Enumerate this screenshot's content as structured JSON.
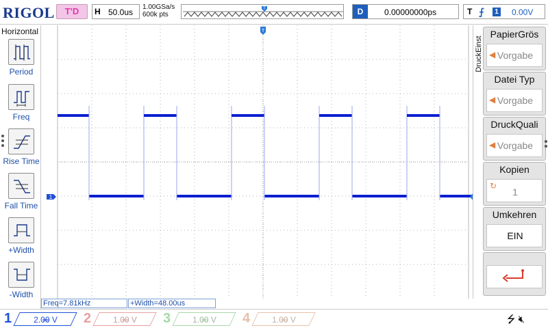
{
  "topbar": {
    "brand": "RIGOL",
    "trigger_state": "T'D",
    "horizontal_label": "H",
    "horizontal_timebase": "50.0us",
    "sample_rate": "1.00GSa/s",
    "memory_depth": "600k pts",
    "delay_label": "D",
    "delay_value": "0.00000000ps",
    "trigger_label": "T",
    "trigger_source": "1",
    "trigger_level": "0.00V"
  },
  "left_menu": {
    "title": "Horizontal",
    "items": [
      {
        "label": "Period",
        "icon": "period-icon"
      },
      {
        "label": "Freq",
        "icon": "frequency-icon"
      },
      {
        "label": "Rise Time",
        "icon": "rise-time-icon"
      },
      {
        "label": "Fall Time",
        "icon": "fall-time-icon"
      },
      {
        "label": "+Width",
        "icon": "positive-width-icon"
      },
      {
        "label": "-Width",
        "icon": "negative-width-icon"
      }
    ]
  },
  "right_menu": {
    "side_label": "DruckEinst",
    "items": [
      {
        "title": "PapierGrös",
        "value": "Vorgabe"
      },
      {
        "title": "Datei Typ",
        "value": "Vorgabe"
      },
      {
        "title": "DruckQuali",
        "value": "Vorgabe"
      },
      {
        "title": "Kopien",
        "value": "1"
      },
      {
        "title": "Umkehren",
        "value": "EIN"
      }
    ],
    "print_icon": "return-arrow-icon"
  },
  "measurements": {
    "freq": "Freq=7.81kHz",
    "pwidth": "+Width=48.00us"
  },
  "channels": [
    {
      "num": "1",
      "scale": "2.00 V",
      "color": "#1e4fd8",
      "active": true
    },
    {
      "num": "2",
      "scale": "1.00 V",
      "color": "#e8a0a0",
      "active": false
    },
    {
      "num": "3",
      "scale": "1.00 V",
      "color": "#a8d8a8",
      "active": false
    },
    {
      "num": "4",
      "scale": "1.00 V",
      "color": "#e8c0a8",
      "active": false
    }
  ],
  "status_icons": [
    "usb-icon",
    "speaker-muted-icon"
  ],
  "colors": {
    "accent": "#1e5ebd",
    "trace": "#0a1fd0",
    "trigger_state_bg": "#f3c6e8",
    "trigger_state_text": "#e23aa8"
  },
  "trace": {
    "period_us": 128,
    "positive_width_us": 48,
    "signal": "square"
  }
}
